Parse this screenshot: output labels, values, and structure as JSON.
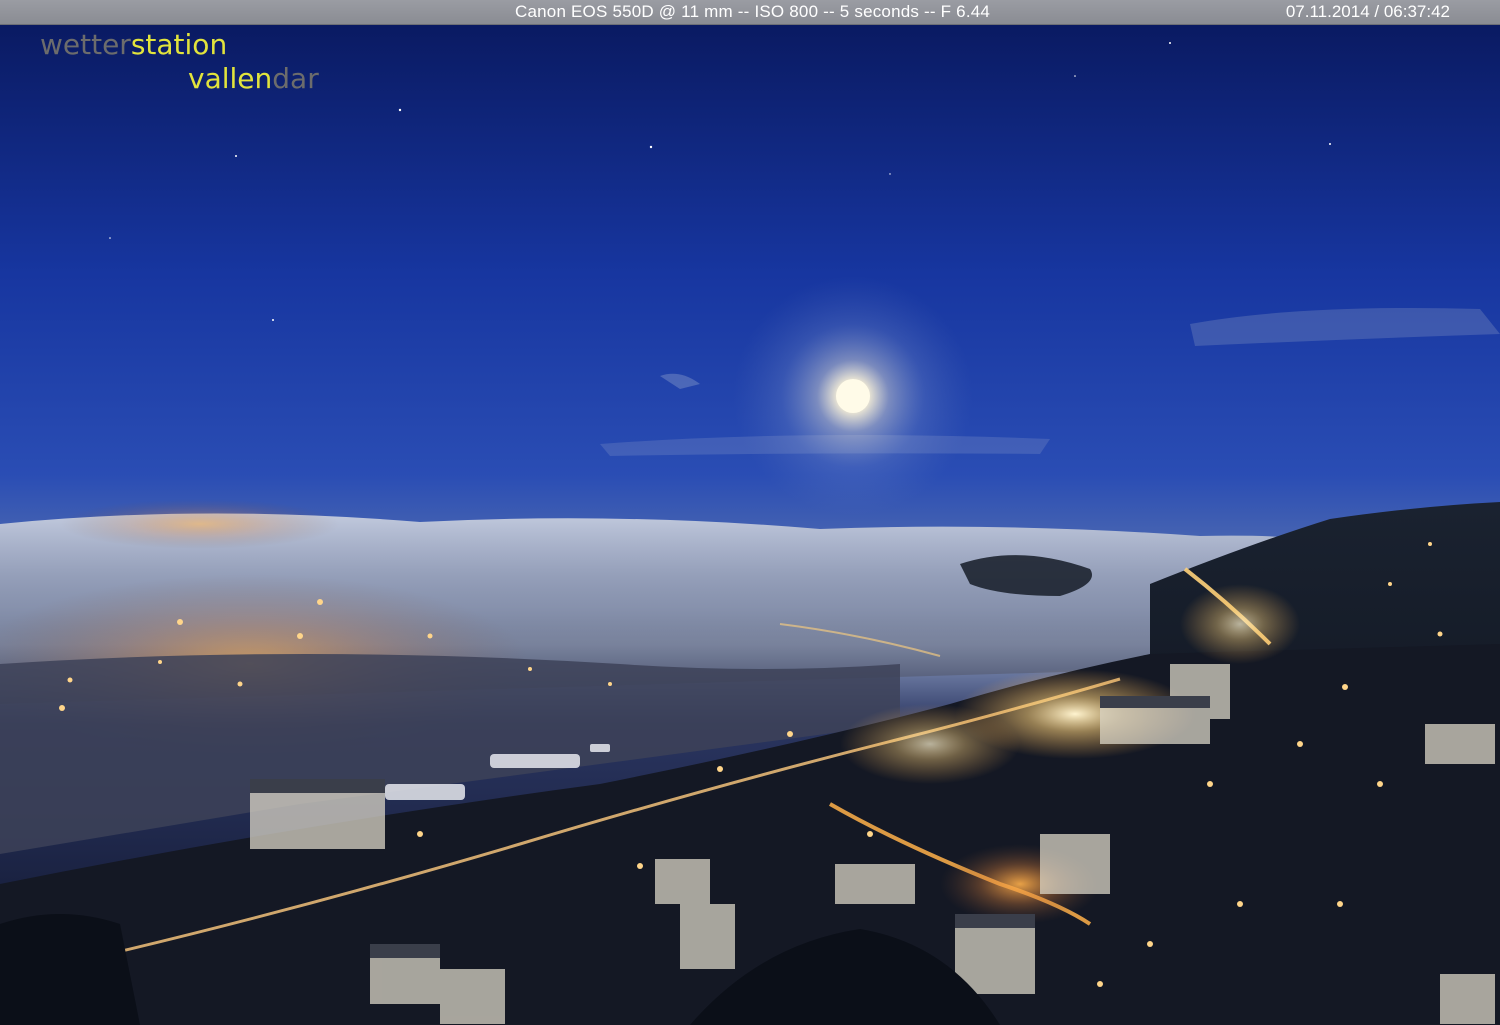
{
  "info_bar": {
    "camera": "Canon EOS 550D @ 11 mm -- ISO 800 -- 5 seconds -- F 6.44",
    "timestamp": "07.11.2014 / 06:37:42"
  },
  "logo": {
    "line1_dim": "wetter",
    "line1_bright": "station",
    "line2_bright": "vallen",
    "line2_dim": "dar"
  },
  "colors": {
    "logo_bright": "#e2e43c",
    "logo_dim": "#6c6c6c",
    "info_bar": "#9a9ca3",
    "sky_top": "#0a1c66",
    "sky_horizon": "#6e84b8",
    "fog": "#b9c2d6",
    "city_light": "#ffb14a"
  }
}
